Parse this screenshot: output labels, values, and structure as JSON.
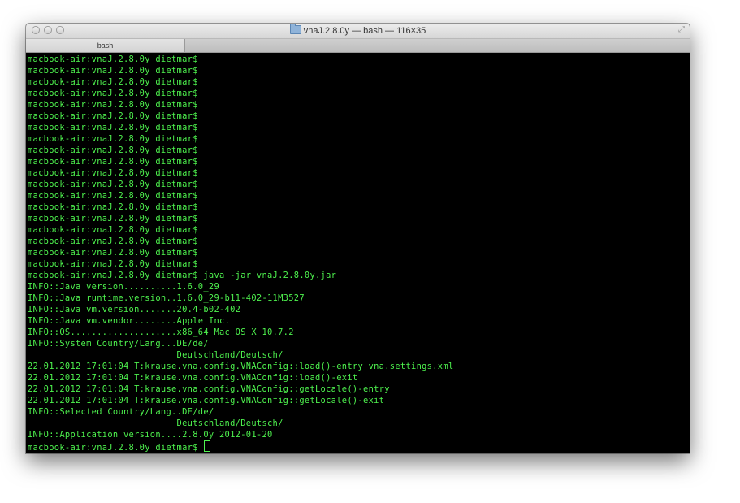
{
  "window": {
    "title": "vnaJ.2.8.0y — bash — 116×35",
    "tab_label": "bash"
  },
  "terminal": {
    "lines": [
      "macbook-air:vnaJ.2.8.0y dietmar$",
      "macbook-air:vnaJ.2.8.0y dietmar$",
      "macbook-air:vnaJ.2.8.0y dietmar$",
      "macbook-air:vnaJ.2.8.0y dietmar$",
      "macbook-air:vnaJ.2.8.0y dietmar$",
      "macbook-air:vnaJ.2.8.0y dietmar$",
      "macbook-air:vnaJ.2.8.0y dietmar$",
      "macbook-air:vnaJ.2.8.0y dietmar$",
      "macbook-air:vnaJ.2.8.0y dietmar$",
      "macbook-air:vnaJ.2.8.0y dietmar$",
      "macbook-air:vnaJ.2.8.0y dietmar$",
      "macbook-air:vnaJ.2.8.0y dietmar$",
      "macbook-air:vnaJ.2.8.0y dietmar$",
      "macbook-air:vnaJ.2.8.0y dietmar$",
      "macbook-air:vnaJ.2.8.0y dietmar$",
      "macbook-air:vnaJ.2.8.0y dietmar$",
      "macbook-air:vnaJ.2.8.0y dietmar$",
      "macbook-air:vnaJ.2.8.0y dietmar$",
      "macbook-air:vnaJ.2.8.0y dietmar$",
      "macbook-air:vnaJ.2.8.0y dietmar$ java -jar vnaJ.2.8.0y.jar",
      "INFO::Java version..........1.6.0_29",
      "INFO::Java runtime.version..1.6.0_29-b11-402-11M3527",
      "INFO::Java vm.version.......20.4-b02-402",
      "INFO::Java vm.vendor........Apple Inc.",
      "INFO::OS....................x86_64 Mac OS X 10.7.2",
      "INFO::System Country/Lang...DE/de/",
      "                            Deutschland/Deutsch/",
      "22.01.2012 17:01:04 T:krause.vna.config.VNAConfig::load()-entry vna.settings.xml",
      "22.01.2012 17:01:04 T:krause.vna.config.VNAConfig::load()-exit",
      "22.01.2012 17:01:04 T:krause.vna.config.VNAConfig::getLocale()-entry",
      "22.01.2012 17:01:04 T:krause.vna.config.VNAConfig::getLocale()-exit",
      "INFO::Selected Country/Lang..DE/de/",
      "                            Deutschland/Deutsch/",
      "INFO::Application version....2.8.0y 2012-01-20"
    ],
    "prompt": "macbook-air:vnaJ.2.8.0y dietmar$ ",
    "text_color": "#4ef24e",
    "background_color": "#000000"
  }
}
